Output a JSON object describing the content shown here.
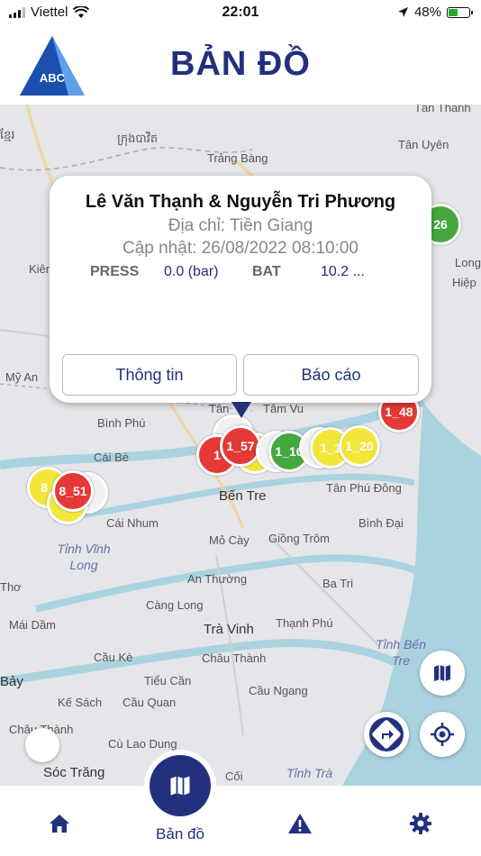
{
  "status_bar": {
    "carrier": "Viettel",
    "time": "22:01",
    "battery_percent": "48%",
    "battery_level": 0.48
  },
  "header": {
    "logo_text": "ABC",
    "title": "BẢN ĐỒ"
  },
  "map": {
    "labels": {
      "tan_thanh": "Tân Thanh",
      "khmer1": "ខ្មែរ",
      "khmer2": "ក្រុងបាវិត",
      "trang_bang": "Trảng Bàng",
      "tan_uyen": "Tân Uyên",
      "long": "Long",
      "hiep": "Hiệp",
      "kien": "Kiên",
      "my_an": "Mỹ An",
      "tan": "Tân",
      "tam_vu": "Tâm Vu",
      "binh_phu": "Bình Phú",
      "cai_be": "Cái Bè",
      "ben_tre": "Bến Tre",
      "tan_phu_dong": "Tân Phú Đông",
      "cai_nhum": "Cái Nhum",
      "tinh_vinh_long": "Tỉnh Vĩnh Long",
      "mo_cay": "Mỏ Cày",
      "giong_trom": "Giồng Trôm",
      "binh_dai": "Bình Đại",
      "tho": "Thơ",
      "an_thuong": "An Thường",
      "ba_tri": "Ba Tri",
      "cang_long": "Càng Long",
      "mai_dam": "Mái Dầm",
      "tra_vinh": "Trà Vinh",
      "thanh_phu": "Thạnh Phú",
      "tinh_ben_tre": "Tỉnh Bến Tre",
      "cau_ke": "Cầu Kè",
      "chau_thanh": "Châu Thành",
      "bay": "Bảy",
      "tieu_can": "Tiểu Cần",
      "ke_sach": "Kế Sách",
      "cau_quan": "Cầu Quan",
      "cau_ngang": "Cầu Ngang",
      "chau_thanh2": "Châu Thành",
      "cu_lao_dung": "Cù Lao Dung",
      "soc_trang": "Sóc Trăng",
      "coi": "Cối",
      "tinh_tra": "Tỉnh Trà"
    },
    "markers": {
      "m_26": "26",
      "m_48": "1_48",
      "m_57": "1_57",
      "m_16": "1_16",
      "m_1": "1_1",
      "m_20": "1_20",
      "m_51": "8_51",
      "m_8": "8_",
      "m_partial": "1"
    }
  },
  "popup": {
    "title": "Lê Văn Thạnh & Nguyễn Tri Phương",
    "address": "Địa chỉ: Tiền Giang",
    "updated": "Cập nhật: 26/08/2022   08:10:00",
    "press_label": "PRESS",
    "press_value": "0.0 (bar)",
    "bat_label": "BAT",
    "bat_value": "10.2 ...",
    "info_button": "Thông tin",
    "report_button": "Báo cáo"
  },
  "tabbar": {
    "map_label": "Bản đồ"
  },
  "colors": {
    "brand": "#23307e",
    "marker_red": "#e53935",
    "marker_green": "#45a83f",
    "marker_yellow": "#f2e63a",
    "sea": "#aad3df"
  },
  "icons": {
    "wifi": "wifi-icon",
    "location": "location-arrow-icon",
    "map_layers": "map-icon",
    "directions": "directions-icon",
    "my_location": "crosshair-icon",
    "home": "home-icon",
    "warning": "warning-icon",
    "settings": "gear-icon"
  }
}
